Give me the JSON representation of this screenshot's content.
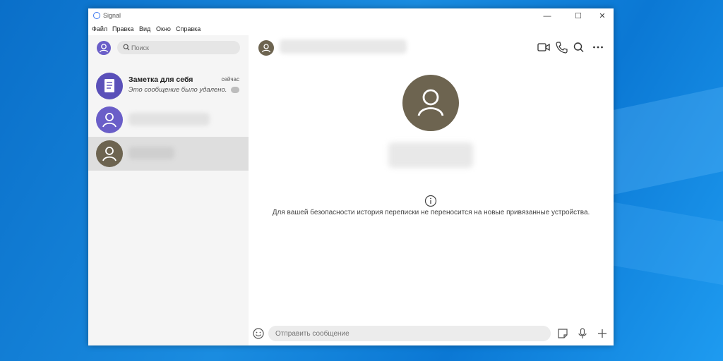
{
  "window": {
    "app_title": "Signal",
    "controls": {
      "minimize": "—",
      "maximize": "☐",
      "close": "✕"
    }
  },
  "menu": [
    "Файл",
    "Правка",
    "Вид",
    "Окно",
    "Справка"
  ],
  "sidebar": {
    "search": {
      "placeholder": "Поиск"
    },
    "conversations": [
      {
        "name": "Заметка для себя",
        "time": "сейчас",
        "preview": "Это сообщение было удалено.",
        "avatar_color": "#5a50b9",
        "icon": "note-icon"
      },
      {
        "name": "",
        "preview": "",
        "avatar_color": "#6a5ec8",
        "icon": "person-icon"
      },
      {
        "name": "",
        "preview": "",
        "avatar_color": "#6d6450",
        "icon": "person-icon",
        "selected": true
      }
    ]
  },
  "conversation": {
    "header_icons": [
      "video-call-icon",
      "phone-icon",
      "search-icon",
      "more-icon"
    ],
    "avatar_color": "#6d6450",
    "info_text": "Для вашей безопасности история переписки не переносится на новые привязанные устройства.",
    "composer": {
      "placeholder": "Отправить сообщение"
    },
    "composer_icons": [
      "emoji-icon",
      "sticker-icon",
      "microphone-icon",
      "plus-icon"
    ]
  },
  "colors": {
    "accent": "#3a76f0",
    "selected_row": "#dedede",
    "sidebar_bg": "#f5f5f5"
  }
}
